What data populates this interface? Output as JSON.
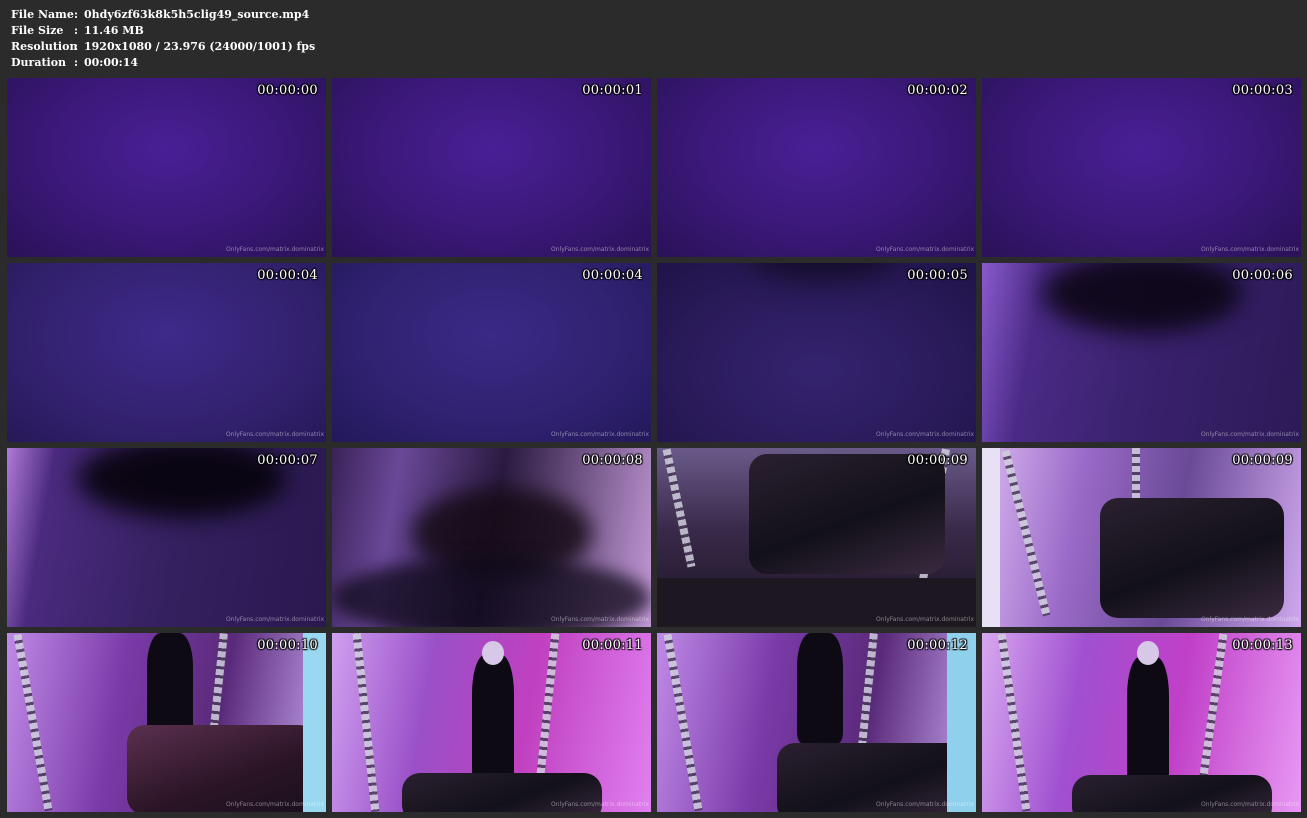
{
  "meta": {
    "file_name_label": "File Name",
    "file_name": "0hdy6zf63k8k5h5clig49_source.mp4",
    "file_size_label": "File Size",
    "file_size": "11.46 MB",
    "resolution_label": "Resolution",
    "resolution": "1920x1080 / 23.976 (24000/1001) fps",
    "duration_label": "Duration",
    "duration": "00:00:14",
    "separator": ":"
  },
  "watermark": "OnlyFans.com/matrix.dominatrix",
  "thumbnails": [
    {
      "timestamp": "00:00:00"
    },
    {
      "timestamp": "00:00:01"
    },
    {
      "timestamp": "00:00:02"
    },
    {
      "timestamp": "00:00:03"
    },
    {
      "timestamp": "00:00:04"
    },
    {
      "timestamp": "00:00:04"
    },
    {
      "timestamp": "00:00:05"
    },
    {
      "timestamp": "00:00:06"
    },
    {
      "timestamp": "00:00:07"
    },
    {
      "timestamp": "00:00:08"
    },
    {
      "timestamp": "00:00:09"
    },
    {
      "timestamp": "00:00:09"
    },
    {
      "timestamp": "00:00:10"
    },
    {
      "timestamp": "00:00:11"
    },
    {
      "timestamp": "00:00:12"
    },
    {
      "timestamp": "00:00:13"
    }
  ],
  "colors": {
    "page_background": "#2b2b2b",
    "text": "#ffffff",
    "frame_purple": "#3a1e6e"
  }
}
